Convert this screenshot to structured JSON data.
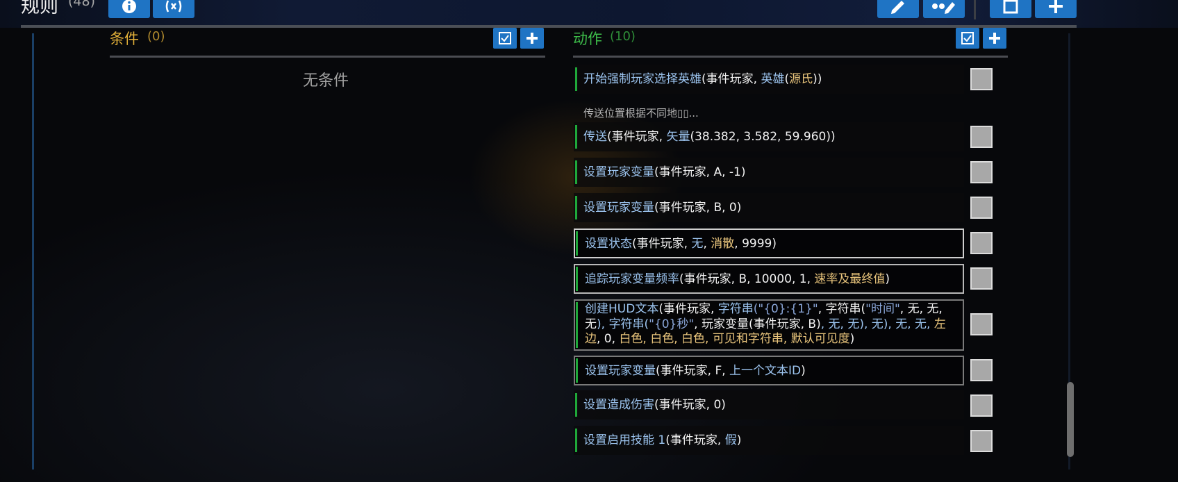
{
  "header": {
    "title": "规则",
    "count": "(48)"
  },
  "conditions": {
    "title": "条件",
    "count": "(0)",
    "empty_text": "无条件"
  },
  "actions": {
    "title": "动作",
    "count": "(10)",
    "comment": "传送位置根据不同地▯▯...",
    "rows": [
      {
        "fn": "开始强制玩家选择英雄",
        "p1": "(事件玩家, ",
        "p2": "英雄",
        "p3": "(",
        "p4": "源氏",
        "p5": "))"
      },
      {
        "fn": "传送",
        "p1": "(事件玩家, ",
        "p2": "矢量",
        "p3": "(38.382, 3.582, 59.960))"
      },
      {
        "fn": "设置玩家变量",
        "p1": "(事件玩家, A, -1)"
      },
      {
        "fn": "设置玩家变量",
        "p1": "(事件玩家, B, 0)"
      },
      {
        "fn": "设置状态",
        "p1": "(事件玩家, ",
        "p2": "无",
        "p3": ", ",
        "p4": "消散",
        "p5": ", 9999)"
      },
      {
        "fn": "追踪玩家变量频率",
        "p1": "(事件玩家, B, 10000, 1, ",
        "p2": "速率及最终值",
        "p3": ")"
      },
      {
        "fn": "创建HUD文本",
        "p1": "(事件玩家, ",
        "p2": "字符串",
        "p3": "(\"{0}:{1}\"",
        "p4": ", 字符串(",
        "p5": "\"时间\"",
        "p6": ", 无, 无, 无",
        "p7": "), 字符串(",
        "p8": "\"{0}秒\"",
        "p9": ", 玩家变量(事件玩家, B)",
        "p10": ", 无, 无), 无), ",
        "p11": "无, 无, ",
        "p12": "左边",
        "p13": ", 0, ",
        "p14": "白色, 白色, 白色, 可见和字符串, 默认可见度",
        "p15": ")"
      },
      {
        "fn": "设置玩家变量",
        "p1": "(事件玩家, F, ",
        "p2": "上一个文本ID",
        "p3": ")"
      },
      {
        "fn": "设置造成伤害",
        "p1": "(事件玩家, 0)"
      },
      {
        "fn": "设置启用技能 1",
        "p1": "(事件玩家, ",
        "p2": "假",
        "p3": ")"
      }
    ]
  },
  "colors": {
    "accent_blue": "#1f74c4",
    "condition_title": "#e3b13a",
    "action_title": "#3dbd4a",
    "action_bar": "#1fa83a"
  }
}
